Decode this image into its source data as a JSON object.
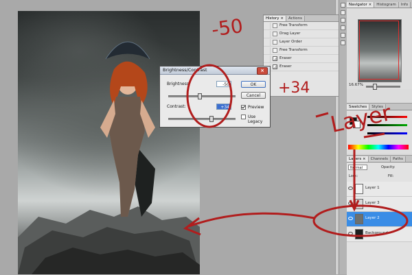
{
  "history": {
    "tabs": [
      "History ×",
      "Actions"
    ],
    "items": [
      {
        "label": "Free Transform",
        "icon": "document-icon"
      },
      {
        "label": "Drag Layer",
        "icon": "document-icon"
      },
      {
        "label": "Layer Order",
        "icon": "document-icon"
      },
      {
        "label": "Free Transform",
        "icon": "document-icon"
      },
      {
        "label": "Eraser",
        "icon": "eraser-icon"
      },
      {
        "label": "Eraser",
        "icon": "eraser-icon"
      }
    ]
  },
  "dialog": {
    "title": "Brightness/Contrast",
    "brightness_label": "Brightness:",
    "brightness_value": "-50",
    "contrast_label": "Contrast:",
    "contrast_value": "+34",
    "ok_label": "OK",
    "cancel_label": "Cancel",
    "preview_label": "Preview",
    "legacy_label": "Use Legacy",
    "preview_checked": true,
    "legacy_checked": false
  },
  "navigator": {
    "tabs": [
      "Navigator ×",
      "Histogram",
      "Info"
    ],
    "zoom": "16.67%"
  },
  "color_panel": {
    "tabs": [
      "Swatches",
      "Styles"
    ]
  },
  "layers": {
    "tabs": [
      "Layers ×",
      "Channels",
      "Paths"
    ],
    "blend_mode": "Normal",
    "opacity_label": "Opacity:",
    "lock_label": "Lock:",
    "fill_label": "Fill:",
    "rows": [
      {
        "name": "Layer 1",
        "selected": false
      },
      {
        "name": "Layer 3",
        "selected": false
      },
      {
        "name": "Layer 2",
        "selected": true
      },
      {
        "name": "Background",
        "selected": false
      }
    ]
  },
  "annotations": {
    "brightness_note": "-50",
    "contrast_note": "+34",
    "layer_note": "Layer",
    "color": "#b11d1d"
  }
}
